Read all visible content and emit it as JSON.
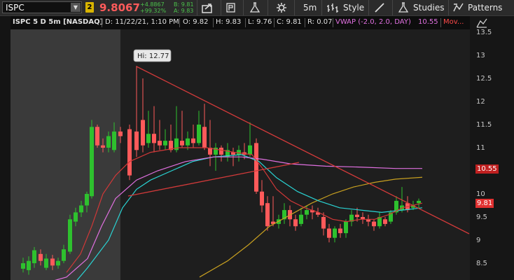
{
  "toolbar": {
    "symbol": "ISPC",
    "link_group": "2",
    "last_price": "9.8067",
    "net_change": "+4.8867",
    "pct_change": "+99.32%",
    "bid": "B: 9.81",
    "ask": "A: 9.83",
    "timeframe_label": "5m",
    "style_label": "Style",
    "studies_label": "Studies",
    "patterns_label": "Patterns",
    "icons": [
      "share-icon",
      "flask-icon",
      "gear-icon",
      "drawing-line-icon",
      "studies-flask-icon",
      "patterns-icon"
    ]
  },
  "infobar": {
    "title": "ISPC 5 D 5m [NASDAQ]",
    "date": "D: 11/22/21, 1:10 PM",
    "open": "O: 9.82",
    "high": "H: 9.83",
    "low": "L: 9.76",
    "close": "C: 9.81",
    "range": "R: 0.07",
    "vwap_label": "VWAP (-2.0, 2.0, DAY)",
    "vwap_value": "10.55",
    "mov_label": "Mov..."
  },
  "axis": {
    "ticks": [
      "13.5",
      "13",
      "12.5",
      "12",
      "11.5",
      "11",
      "10.5",
      "10",
      "9.5",
      "9",
      "8.5"
    ],
    "vwap_tag": "10.55",
    "price_tag": "9.81"
  },
  "annotation": {
    "high_label": "Hi: 12.77"
  },
  "colors": {
    "up": "#2ec12e",
    "down": "#ff5a5a",
    "vwap": "#e070e0",
    "ema_cyan": "#2ad4d4",
    "ema_red": "#d03838",
    "sma_gold": "#c8a020",
    "trendline": "#d23a3a",
    "price_tag_bg": "#e03030",
    "vwap_tag_bg": "#c02020"
  }
}
